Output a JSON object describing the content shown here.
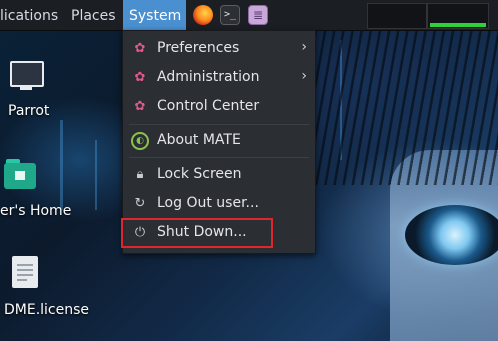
{
  "panel": {
    "menus": [
      {
        "label": "lications",
        "active": false
      },
      {
        "label": "Places",
        "active": false
      },
      {
        "label": "System",
        "active": true
      }
    ],
    "launchers": [
      {
        "name": "firefox-icon"
      },
      {
        "name": "terminal-icon",
        "glyph": ">_"
      },
      {
        "name": "text-editor-icon",
        "glyph": "≣"
      }
    ],
    "workspace_indicator_color": "#2fd13a",
    "active_menu_color": "#4a90d0"
  },
  "desktop": {
    "icons": [
      {
        "label": "Parrot",
        "icon": "computer-icon"
      },
      {
        "label": "er's Home",
        "icon": "home-folder-icon"
      },
      {
        "label": "DME.license",
        "icon": "document-icon"
      }
    ]
  },
  "system_menu": {
    "items": [
      {
        "label": "Preferences",
        "icon": "preferences-gear-icon",
        "submenu": true
      },
      {
        "label": "Administration",
        "icon": "administration-gear-icon",
        "submenu": true
      },
      {
        "label": "Control Center",
        "icon": "control-center-gear-icon",
        "submenu": false
      },
      {
        "label": "About MATE",
        "icon": "mate-logo-icon",
        "submenu": false
      },
      {
        "label": "Lock Screen",
        "icon": "lock-icon",
        "submenu": false
      },
      {
        "label": "Log Out user...",
        "icon": "logout-icon",
        "submenu": false
      },
      {
        "label": "Shut Down...",
        "icon": "power-icon",
        "submenu": false,
        "highlighted": true
      }
    ],
    "highlight_color": "#e0262a"
  }
}
